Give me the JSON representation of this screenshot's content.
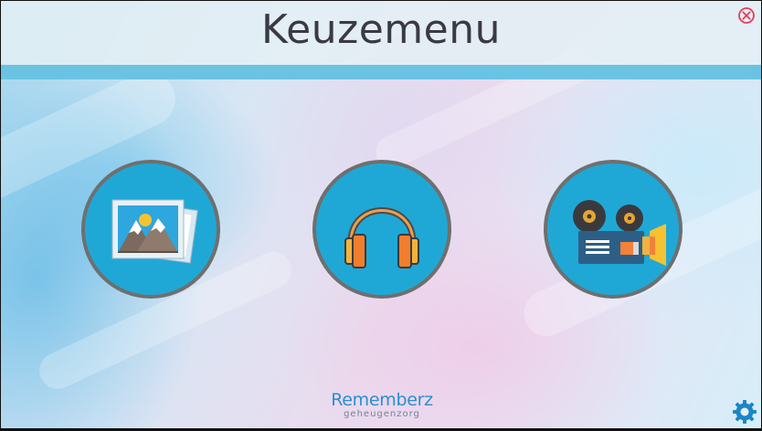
{
  "header": {
    "title": "Keuzemenu"
  },
  "menu": {
    "items": [
      {
        "id": "photos",
        "icon": "photo-gallery-icon"
      },
      {
        "id": "music",
        "icon": "headphones-icon"
      },
      {
        "id": "video",
        "icon": "film-projector-icon"
      }
    ]
  },
  "branding": {
    "name": "Rememberz",
    "tagline": "geheugenzorg"
  },
  "colors": {
    "circle_fill": "#1fa8d6",
    "circle_border": "#6f6f6f",
    "header_bar": "#6bc3e3",
    "close_icon": "#e0405a",
    "settings_icon": "#1a86c9",
    "logo_text": "#2a8fd0"
  }
}
